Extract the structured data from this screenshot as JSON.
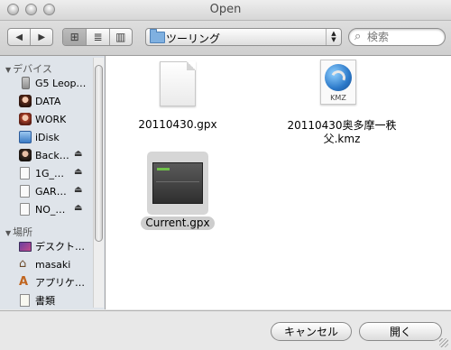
{
  "window": {
    "title": "Open"
  },
  "toolbar": {
    "nav_back": "◀",
    "nav_forward": "▶",
    "view_icon": "⊞",
    "view_list": "≣",
    "view_columns": "▥",
    "location": "ツーリング",
    "search_placeholder": "検索"
  },
  "sidebar": {
    "devices_header": "デバイス",
    "devices": [
      {
        "label": "G5 Leop…",
        "icon": "hard-drive-icon",
        "eject": false
      },
      {
        "label": "DATA",
        "icon": "avatar-icon",
        "eject": false
      },
      {
        "label": "WORK",
        "icon": "avatar-icon",
        "eject": false
      },
      {
        "label": "iDisk",
        "icon": "idisk-icon",
        "eject": false
      },
      {
        "label": "Back…",
        "icon": "avatar-icon",
        "eject": true
      },
      {
        "label": "1G_…",
        "icon": "drive-icon",
        "eject": true
      },
      {
        "label": "GAR…",
        "icon": "drive-icon",
        "eject": true
      },
      {
        "label": "NO_…",
        "icon": "drive-icon",
        "eject": true
      }
    ],
    "places_header": "場所",
    "places": [
      {
        "label": "デスクト…",
        "icon": "desktop-icon"
      },
      {
        "label": "masaki",
        "icon": "home-icon"
      },
      {
        "label": "アプリケ…",
        "icon": "applications-icon"
      },
      {
        "label": "書類",
        "icon": "documents-icon"
      }
    ],
    "eject_glyph": "⏏"
  },
  "files": [
    {
      "name": "20110430.gpx",
      "type": "document",
      "selected": false
    },
    {
      "name_line1": "20110430奥多摩一秩",
      "name_line2": "父.kmz",
      "type": "kmz",
      "selected": false
    },
    {
      "name": "Current.gpx",
      "type": "gpx-thumbnail",
      "selected": true
    }
  ],
  "kmz_tag": "KMZ",
  "buttons": {
    "cancel": "キャンセル",
    "open": "開く"
  },
  "colors": {
    "sidebar_bg": "#dfe4ea",
    "selection_gray": "#cdcdcd",
    "folder_blue": "#7fb0e0"
  }
}
